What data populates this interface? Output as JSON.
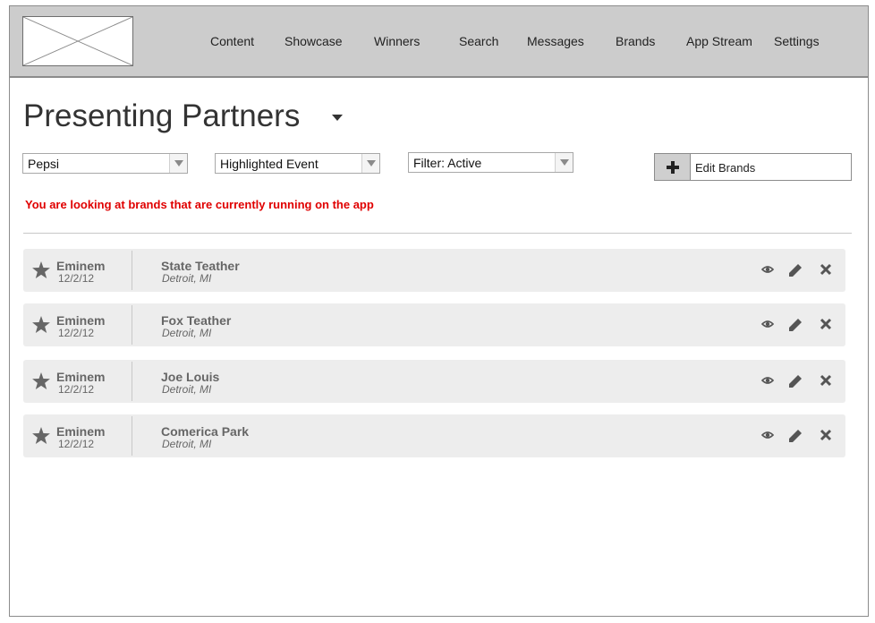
{
  "header": {
    "nav": [
      "Content",
      "Showcase",
      "Winners",
      "Search",
      "Messages",
      "Brands",
      "App Stream",
      "Settings"
    ]
  },
  "page": {
    "title": "Presenting Partners"
  },
  "filters": {
    "brand": "Pepsi",
    "event": "Highlighted Event",
    "status": "Filter: Active"
  },
  "edit_brands_label": "Edit Brands",
  "notice": "You are looking at brands that are currently running on the app",
  "rows": [
    {
      "artist": "Eminem",
      "date": "12/2/12",
      "venue": "State Teather",
      "location": "Detroit, MI"
    },
    {
      "artist": "Eminem",
      "date": "12/2/12",
      "venue": "Fox Teather",
      "location": "Detroit, MI"
    },
    {
      "artist": "Eminem",
      "date": "12/2/12",
      "venue": "Joe Louis",
      "location": "Detroit, MI"
    },
    {
      "artist": "Eminem",
      "date": "12/2/12",
      "venue": "Comerica Park",
      "location": "Detroit, MI"
    }
  ],
  "icons": {
    "row_actions": [
      "eye-icon",
      "pencil-icon",
      "close-icon"
    ],
    "row_marker": "star-icon"
  },
  "colors": {
    "header_bg": "#cccccc",
    "row_bg": "#ededed",
    "notice": "#e00000"
  }
}
